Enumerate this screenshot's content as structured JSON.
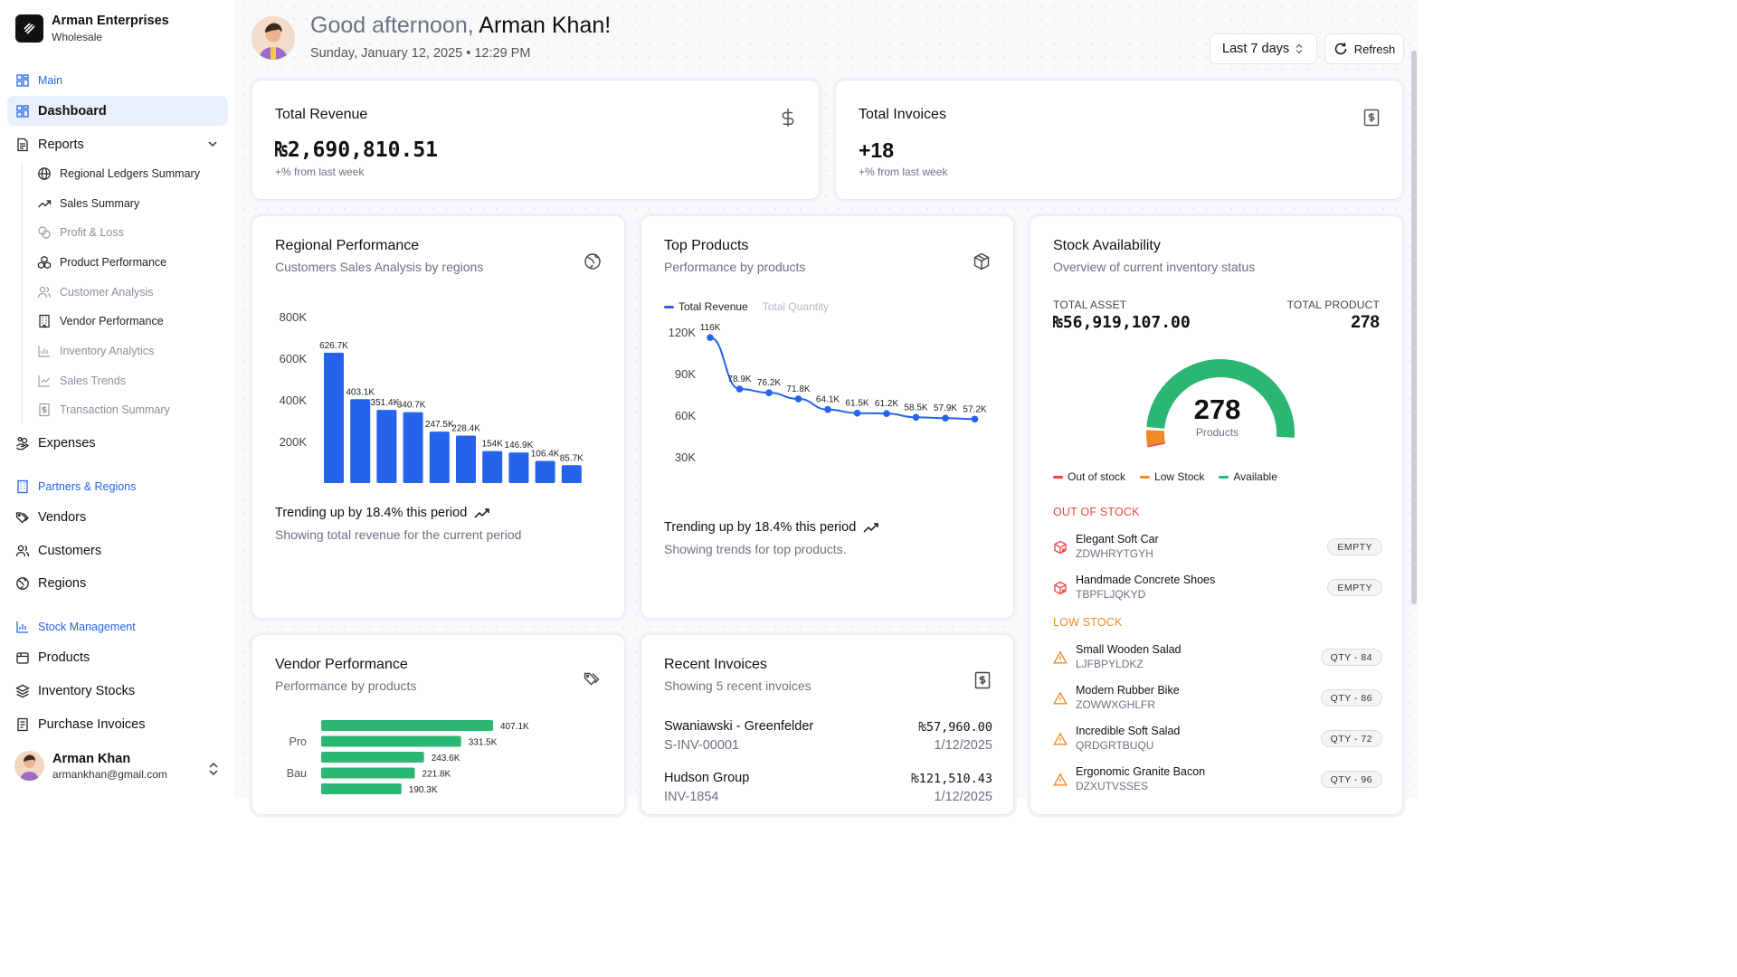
{
  "brand": {
    "name": "Arman Enterprises",
    "subtitle": "Wholesale"
  },
  "sidebar": {
    "main_section": "Main",
    "dashboard": "Dashboard",
    "reports": "Reports",
    "report_items": [
      "Regional Ledgers Summary",
      "Sales Summary",
      "Profit & Loss",
      "Product Performance",
      "Customer Analysis",
      "Vendor Performance",
      "Inventory Analytics",
      "Sales Trends",
      "Transaction Summary"
    ],
    "expenses": "Expenses",
    "partners_section": "Partners & Regions",
    "vendors": "Vendors",
    "customers": "Customers",
    "regions": "Regions",
    "stock_section": "Stock Management",
    "products": "Products",
    "inventory_stocks": "Inventory Stocks",
    "purchase_invoices": "Purchase Invoices"
  },
  "user": {
    "name": "Arman Khan",
    "email": "armankhan@gmail.com"
  },
  "header": {
    "greeting_prefix": "Good afternoon,",
    "greeting_name": "Arman Khan!",
    "date": "Sunday, January 12, 2025 • 12:29 PM",
    "range": "Last 7 days",
    "refresh": "Refresh"
  },
  "kpis": {
    "revenue": {
      "title": "Total Revenue",
      "value": "₨2,690,810.51",
      "delta": "+% from last week"
    },
    "invoices": {
      "title": "Total Invoices",
      "value": "+18",
      "delta": "+% from last week"
    }
  },
  "regional": {
    "title": "Regional Performance",
    "subtitle": "Customers Sales Analysis by regions",
    "trend": "Trending up by 18.4% this period",
    "trend_sub": "Showing total revenue for the current period"
  },
  "top_products": {
    "title": "Top Products",
    "subtitle": "Performance by products",
    "legend_revenue": "Total Revenue",
    "legend_quantity": "Total Quantity",
    "trend": "Trending up by 18.4% this period",
    "trend_sub": "Showing trends for top products."
  },
  "vendor_perf": {
    "title": "Vendor Performance",
    "subtitle": "Performance by products"
  },
  "recent_invoices": {
    "title": "Recent Invoices",
    "subtitle": "Showing 5 recent invoices",
    "rows": [
      {
        "name": "Swaniawski - Greenfelder",
        "amount": "₨57,960.00",
        "id": "S-INV-00001",
        "date": "1/12/2025"
      },
      {
        "name": "Hudson Group",
        "amount": "₨121,510.43",
        "id": "INV-1854",
        "date": "1/12/2025"
      }
    ]
  },
  "stock": {
    "title": "Stock Availability",
    "subtitle": "Overview of current inventory status",
    "total_asset_label": "TOTAL ASSET",
    "total_asset": "₨56,919,107.00",
    "total_product_label": "TOTAL PRODUCT",
    "total_product": "278",
    "gauge_value": "278",
    "gauge_label": "Products",
    "gauge_fractions": {
      "out_of_stock": 0.007,
      "low_stock": 0.05,
      "available": 0.943
    },
    "legend": {
      "out": "Out of stock",
      "low": "Low Stock",
      "available": "Available"
    },
    "colors": {
      "out": "#ef4444",
      "low": "#f08a24",
      "available": "#2bb673"
    },
    "out_title": "OUT OF STOCK",
    "out_items": [
      {
        "name": "Elegant Soft Car",
        "sku": "ZDWHRYTGYH",
        "badge": "EMPTY"
      },
      {
        "name": "Handmade Concrete Shoes",
        "sku": "TBPFLJQKYD",
        "badge": "EMPTY"
      }
    ],
    "low_title": "LOW STOCK",
    "low_items": [
      {
        "name": "Small Wooden Salad",
        "sku": "LJFBPYLDKZ",
        "badge": "QTY - 84"
      },
      {
        "name": "Modern Rubber Bike",
        "sku": "ZOWWXGHLFR",
        "badge": "QTY - 86"
      },
      {
        "name": "Incredible Soft Salad",
        "sku": "QRDGRTBUQU",
        "badge": "QTY - 72"
      },
      {
        "name": "Ergonomic Granite Bacon",
        "sku": "DZXUTVSSES",
        "badge": "QTY - 96"
      }
    ]
  },
  "chart_data": [
    {
      "type": "bar",
      "title": "Regional Performance",
      "values": [
        626.7,
        403.1,
        351.4,
        340.7,
        247.5,
        228.4,
        154,
        146.9,
        106.4,
        85.7
      ],
      "labels": [
        "626.7K",
        "403.1K",
        "351.4K",
        "340.7K",
        "247.5K",
        "228.4K",
        "154K",
        "146.9K",
        "106.4K",
        "85.7K"
      ],
      "yticks": [
        "200K",
        "400K",
        "600K",
        "800K"
      ],
      "ylim": [
        0,
        800
      ],
      "color": "#2563eb"
    },
    {
      "type": "line",
      "title": "Top Products",
      "values": [
        116,
        78.9,
        76.2,
        71.8,
        64.1,
        61.5,
        61.2,
        58.5,
        57.9,
        57.2
      ],
      "labels": [
        "116K",
        "78.9K",
        "76.2K",
        "71.8K",
        "64.1K",
        "61.5K",
        "61.2K",
        "58.5K",
        "57.9K",
        "57.2K"
      ],
      "yticks": [
        "30K",
        "60K",
        "90K",
        "120K"
      ],
      "ylim": [
        0,
        120
      ],
      "series": [
        {
          "name": "Total Revenue"
        }
      ],
      "color": "#2563eb"
    },
    {
      "type": "bar",
      "orientation": "horizontal",
      "title": "Vendor Performance",
      "categories": [
        "Pro",
        "Bau"
      ],
      "values": [
        407.1,
        331.5,
        243.6,
        221.8,
        190.3
      ],
      "labels": [
        "407.1K",
        "331.5K",
        "243.6K",
        "221.8K",
        "190.3K"
      ],
      "color": "#2bb673"
    }
  ]
}
